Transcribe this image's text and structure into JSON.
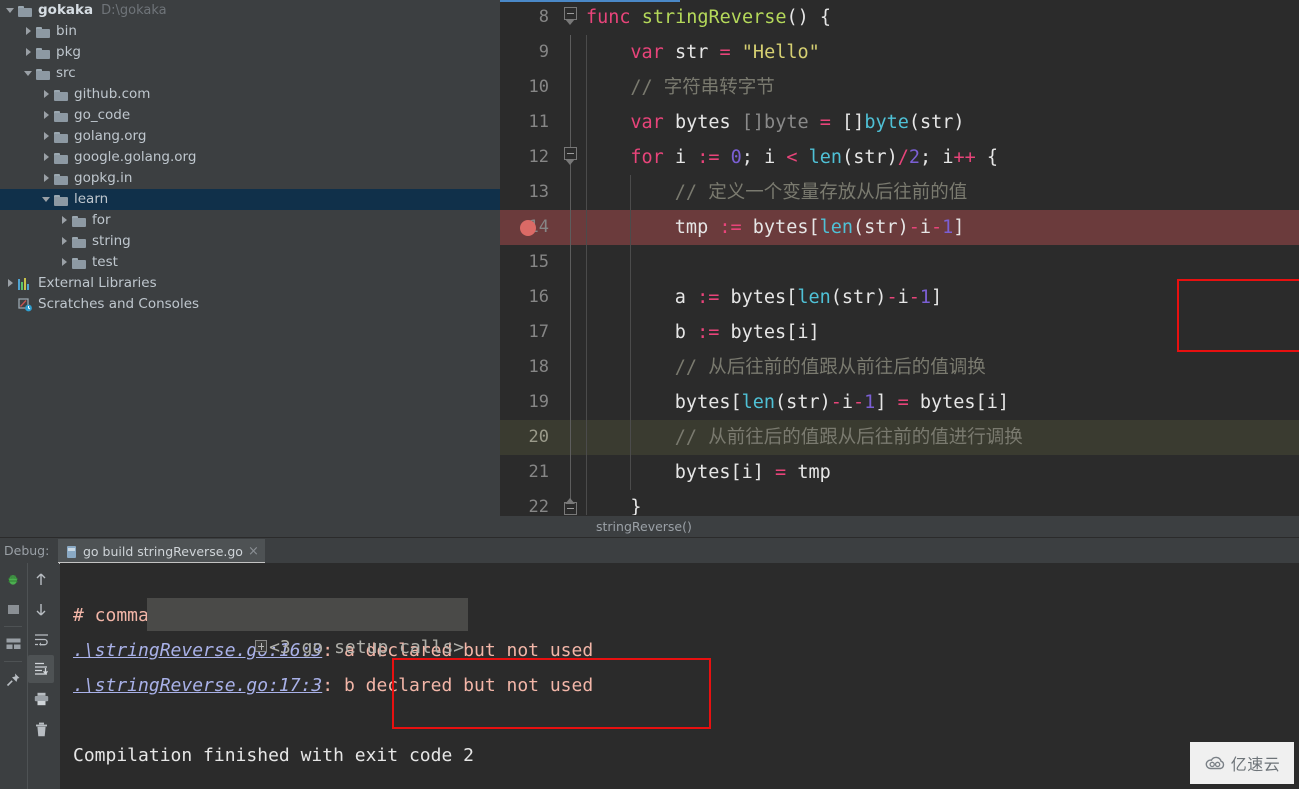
{
  "project": {
    "tree": [
      {
        "label": "gokaka",
        "path": "D:\\gokaka",
        "depth": 0,
        "twisty": "open",
        "icon": "folder-icon",
        "root": true,
        "selected": false
      },
      {
        "label": "bin",
        "path": "",
        "depth": 1,
        "twisty": "closed",
        "icon": "folder-icon",
        "root": false,
        "selected": false
      },
      {
        "label": "pkg",
        "path": "",
        "depth": 1,
        "twisty": "closed",
        "icon": "folder-icon",
        "root": false,
        "selected": false
      },
      {
        "label": "src",
        "path": "",
        "depth": 1,
        "twisty": "open",
        "icon": "folder-icon",
        "root": false,
        "selected": false
      },
      {
        "label": "github.com",
        "path": "",
        "depth": 2,
        "twisty": "closed",
        "icon": "folder-icon",
        "root": false,
        "selected": false
      },
      {
        "label": "go_code",
        "path": "",
        "depth": 2,
        "twisty": "closed",
        "icon": "folder-icon",
        "root": false,
        "selected": false
      },
      {
        "label": "golang.org",
        "path": "",
        "depth": 2,
        "twisty": "closed",
        "icon": "folder-icon",
        "root": false,
        "selected": false
      },
      {
        "label": "google.golang.org",
        "path": "",
        "depth": 2,
        "twisty": "closed",
        "icon": "folder-icon",
        "root": false,
        "selected": false
      },
      {
        "label": "gopkg.in",
        "path": "",
        "depth": 2,
        "twisty": "closed",
        "icon": "folder-icon",
        "root": false,
        "selected": false
      },
      {
        "label": "learn",
        "path": "",
        "depth": 2,
        "twisty": "open",
        "icon": "folder-icon",
        "root": false,
        "selected": true
      },
      {
        "label": "for",
        "path": "",
        "depth": 3,
        "twisty": "closed",
        "icon": "folder-icon",
        "root": false,
        "selected": false
      },
      {
        "label": "string",
        "path": "",
        "depth": 3,
        "twisty": "closed",
        "icon": "folder-icon",
        "root": false,
        "selected": false
      },
      {
        "label": "test",
        "path": "",
        "depth": 3,
        "twisty": "closed",
        "icon": "folder-icon",
        "root": false,
        "selected": false
      },
      {
        "label": "External Libraries",
        "path": "",
        "depth": 0,
        "twisty": "closed",
        "icon": "external-libraries-icon",
        "root": false,
        "selected": false
      },
      {
        "label": "Scratches and Consoles",
        "path": "",
        "depth": 0,
        "twisty": "none",
        "icon": "scratches-icon",
        "root": false,
        "selected": false
      }
    ]
  },
  "editor": {
    "breadcrumb": "stringReverse()",
    "first_line": 8,
    "breakpoint_line": 14,
    "caret_line": 20,
    "lines": [
      {
        "n": 8,
        "indent": 0,
        "state": "normal",
        "fold": "func-open",
        "tokens": [
          {
            "t": "func",
            "c": "k"
          },
          {
            "t": " ",
            "c": "pl"
          },
          {
            "t": "stringReverse",
            "c": "fn"
          },
          {
            "t": "() {",
            "c": "pl"
          }
        ]
      },
      {
        "n": 9,
        "indent": 1,
        "state": "normal",
        "fold": "bar",
        "tokens": [
          {
            "t": "var",
            "c": "k"
          },
          {
            "t": " str ",
            "c": "pl"
          },
          {
            "t": "=",
            "c": "op"
          },
          {
            "t": " ",
            "c": "pl"
          },
          {
            "t": "\"Hello\"",
            "c": "st"
          }
        ]
      },
      {
        "n": 10,
        "indent": 1,
        "state": "normal",
        "fold": "bar",
        "tokens": [
          {
            "t": "// 字符串转字节",
            "c": "cm"
          }
        ]
      },
      {
        "n": 11,
        "indent": 1,
        "state": "normal",
        "fold": "bar",
        "tokens": [
          {
            "t": "var",
            "c": "k"
          },
          {
            "t": " bytes ",
            "c": "pl"
          },
          {
            "t": "[]byte",
            "c": "ty"
          },
          {
            "t": " ",
            "c": "pl"
          },
          {
            "t": "=",
            "c": "op"
          },
          {
            "t": " []",
            "c": "pl"
          },
          {
            "t": "byte",
            "c": "bi"
          },
          {
            "t": "(str)",
            "c": "pl"
          }
        ]
      },
      {
        "n": 12,
        "indent": 1,
        "state": "normal",
        "fold": "for-open",
        "tokens": [
          {
            "t": "for",
            "c": "k"
          },
          {
            "t": " i ",
            "c": "pl"
          },
          {
            "t": ":=",
            "c": "op"
          },
          {
            "t": " ",
            "c": "pl"
          },
          {
            "t": "0",
            "c": "nu"
          },
          {
            "t": "; i ",
            "c": "pl"
          },
          {
            "t": "<",
            "c": "op"
          },
          {
            "t": " ",
            "c": "pl"
          },
          {
            "t": "len",
            "c": "bi"
          },
          {
            "t": "(str)",
            "c": "pl"
          },
          {
            "t": "/",
            "c": "op"
          },
          {
            "t": "2",
            "c": "nu"
          },
          {
            "t": "; i",
            "c": "pl"
          },
          {
            "t": "++",
            "c": "op"
          },
          {
            "t": " {",
            "c": "pl"
          }
        ]
      },
      {
        "n": 13,
        "indent": 2,
        "state": "normal",
        "fold": "bar",
        "tokens": [
          {
            "t": "// 定义一个变量存放从后往前的值",
            "c": "cm"
          }
        ]
      },
      {
        "n": 14,
        "indent": 2,
        "state": "breakpoint",
        "fold": "bar",
        "tokens": [
          {
            "t": "tmp ",
            "c": "pl"
          },
          {
            "t": ":=",
            "c": "op"
          },
          {
            "t": " bytes[",
            "c": "pl"
          },
          {
            "t": "len",
            "c": "bi"
          },
          {
            "t": "(str)",
            "c": "pl"
          },
          {
            "t": "-",
            "c": "op"
          },
          {
            "t": "i",
            "c": "pl"
          },
          {
            "t": "-",
            "c": "op"
          },
          {
            "t": "1",
            "c": "nu"
          },
          {
            "t": "]",
            "c": "pl"
          }
        ]
      },
      {
        "n": 15,
        "indent": 2,
        "state": "normal",
        "fold": "bar",
        "tokens": []
      },
      {
        "n": 16,
        "indent": 2,
        "state": "normal",
        "fold": "bar",
        "tokens": [
          {
            "t": "a",
            "c": "pl",
            "squiggle": true
          },
          {
            "t": " ",
            "c": "pl"
          },
          {
            "t": ":=",
            "c": "op"
          },
          {
            "t": " bytes[",
            "c": "pl"
          },
          {
            "t": "len",
            "c": "bi"
          },
          {
            "t": "(str)",
            "c": "pl"
          },
          {
            "t": "-",
            "c": "op"
          },
          {
            "t": "i",
            "c": "pl"
          },
          {
            "t": "-",
            "c": "op"
          },
          {
            "t": "1",
            "c": "nu"
          },
          {
            "t": "]",
            "c": "pl"
          }
        ]
      },
      {
        "n": 17,
        "indent": 2,
        "state": "normal",
        "fold": "bar",
        "tokens": [
          {
            "t": "b",
            "c": "pl",
            "squiggle": true
          },
          {
            "t": " ",
            "c": "pl"
          },
          {
            "t": ":=",
            "c": "op"
          },
          {
            "t": " bytes[i]",
            "c": "pl"
          }
        ]
      },
      {
        "n": 18,
        "indent": 2,
        "state": "normal",
        "fold": "bar",
        "tokens": [
          {
            "t": "// 从后往前的值跟从前往后的值调换",
            "c": "cm"
          }
        ]
      },
      {
        "n": 19,
        "indent": 2,
        "state": "normal",
        "fold": "bar",
        "tokens": [
          {
            "t": "bytes[",
            "c": "pl"
          },
          {
            "t": "len",
            "c": "bi"
          },
          {
            "t": "(str)",
            "c": "pl"
          },
          {
            "t": "-",
            "c": "op"
          },
          {
            "t": "i",
            "c": "pl"
          },
          {
            "t": "-",
            "c": "op"
          },
          {
            "t": "1",
            "c": "nu"
          },
          {
            "t": "] ",
            "c": "pl"
          },
          {
            "t": "=",
            "c": "op"
          },
          {
            "t": " bytes[i]",
            "c": "pl"
          }
        ]
      },
      {
        "n": 20,
        "indent": 2,
        "state": "caret",
        "fold": "bar",
        "tokens": [
          {
            "t": "// 从前往后的值跟从后往前的值进行调换",
            "c": "cm"
          }
        ]
      },
      {
        "n": 21,
        "indent": 2,
        "state": "normal",
        "fold": "bar",
        "tokens": [
          {
            "t": "bytes[i] ",
            "c": "pl"
          },
          {
            "t": "=",
            "c": "op"
          },
          {
            "t": " tmp",
            "c": "pl"
          }
        ]
      },
      {
        "n": 22,
        "indent": 1,
        "state": "normal",
        "fold": "for-close",
        "tokens": [
          {
            "t": "}",
            "c": "pl"
          }
        ]
      }
    ]
  },
  "debug": {
    "panel_label": "Debug:",
    "tab_title": "go build stringReverse.go",
    "tab_close": "×",
    "toolbar_left": [
      {
        "name": "rerun-debug-icon",
        "glyph": "bug"
      },
      {
        "name": "stop-icon",
        "glyph": "stop"
      },
      {
        "name": "console-layout-icon",
        "glyph": "layout"
      },
      {
        "name": "pin-tab-icon",
        "glyph": "pin"
      }
    ],
    "toolbar_right": [
      {
        "name": "up-arrow-icon",
        "glyph": "up",
        "active": false
      },
      {
        "name": "down-arrow-icon",
        "glyph": "down",
        "active": false
      },
      {
        "name": "soft-wrap-icon",
        "glyph": "wrap",
        "active": false
      },
      {
        "name": "scroll-to-end-icon",
        "glyph": "scroll-end",
        "active": true
      },
      {
        "name": "print-icon",
        "glyph": "print",
        "active": false
      },
      {
        "name": "clear-all-icon",
        "glyph": "trash",
        "active": false
      }
    ],
    "console": {
      "folded_block": "<3 go setup calls>",
      "lines": [
        {
          "type": "plain",
          "text": "# command-line-arguments"
        },
        {
          "type": "error",
          "link": ".\\stringReverse.go:16:3",
          "sep": ": ",
          "message": "a declared but not used"
        },
        {
          "type": "error",
          "link": ".\\stringReverse.go:17:3",
          "sep": ": ",
          "message": "b declared but not used"
        },
        {
          "type": "blank",
          "text": ""
        },
        {
          "type": "plain",
          "text": "Compilation finished with exit code 2"
        }
      ]
    }
  },
  "watermark": {
    "text": "亿速云",
    "icon": "cloud-icon"
  },
  "colors": {
    "annotation_red": "#e81010",
    "breakpoint_red": "#db6a66",
    "breakpoint_line_bg": "#6b3b3c",
    "caret_line_bg": "#3a3b30",
    "selection_blue": "#10304a",
    "editor_bg": "#2b2b2b",
    "panel_bg": "#3c3f41",
    "keyword": "#e8447a",
    "function": "#b5d95a",
    "string": "#d5cf72",
    "comment": "#7a7a6f",
    "builtin": "#4fc1d6",
    "number": "#7b5fd4",
    "error_text": "#f3b6a8",
    "link_text": "#a9b1e8"
  }
}
